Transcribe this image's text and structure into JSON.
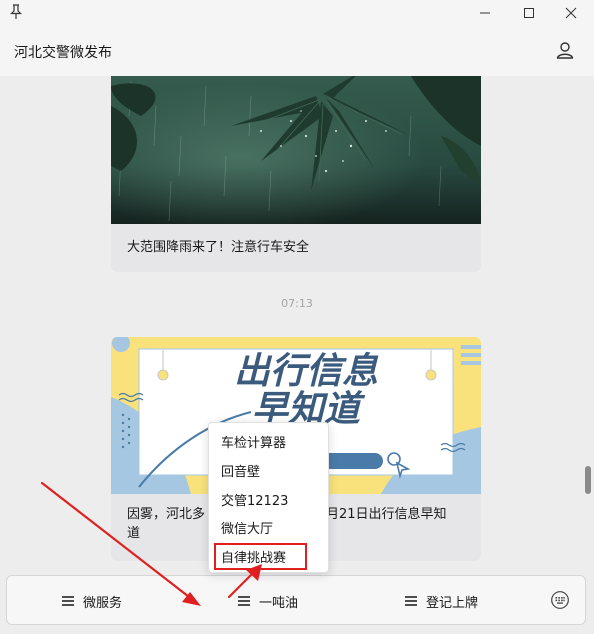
{
  "window": {
    "pin_icon": "pin-icon",
    "controls": [
      "minimize-icon",
      "maximize-icon",
      "close-icon"
    ]
  },
  "header": {
    "title": "河北交警微发布",
    "profile_icon": "person-icon"
  },
  "messages": [
    {
      "caption": "大范围降雨来了！注意行车安全"
    },
    {
      "timestamp": "07:13"
    },
    {
      "poster_title_line1": "出行信息",
      "poster_title_line2": "早知道",
      "caption_part1": "因雾，河北多",
      "caption_part2": "月21日出行信息早知",
      "caption_line2": "道"
    }
  ],
  "popup_menu": {
    "items": [
      "车检计算器",
      "回音壁",
      "交管12123",
      "微信大厅",
      "自律挑战赛"
    ],
    "highlighted_item": "自律挑战赛"
  },
  "bottom_menu": {
    "tabs": [
      "微服务",
      "一吨油",
      "登记上牌"
    ],
    "keyboard_icon": "keyboard-icon"
  },
  "colors": {
    "annotation": "#e02020",
    "poster_yellow": "#f9e27c",
    "poster_blue": "#4a7ba8",
    "poster_title_blue": "#3a5b7e"
  }
}
